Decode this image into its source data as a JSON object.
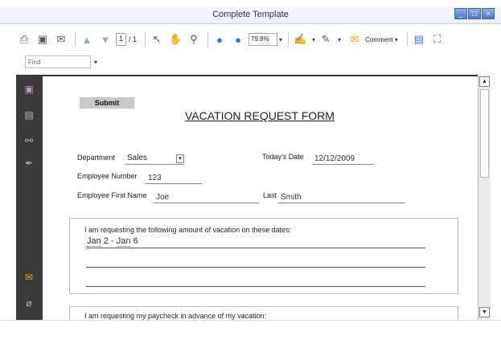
{
  "window": {
    "title": "Complete Template"
  },
  "toolbar": {
    "page_current": "1",
    "page_total": "/ 1",
    "zoom": "79.8%",
    "comment_label": "Comment"
  },
  "find": {
    "placeholder": "Find"
  },
  "form": {
    "submit_label": "Submit",
    "title": "VACATION REQUEST FORM",
    "department_label": "Department",
    "department_value": "Sales",
    "todays_date_label": "Today's Date",
    "todays_date_value": "12/12/2009",
    "employee_number_label": "Employee Number",
    "employee_number_value": "123",
    "first_name_label": "Employee First Name",
    "first_name_value": "Joe",
    "last_label": "Last",
    "last_value": "Smith",
    "vacation_heading": "I am requesting the following amount of vacation on these dates:",
    "vacation_from": "Jan",
    "vacation_range_rest": " 2 - ",
    "vacation_to": "Jan",
    "vacation_end": " 6",
    "paycheck_heading": "I am requesting my paycheck in advance of my vacation:"
  },
  "icons": [
    "print-icon",
    "save-icon",
    "email-icon",
    "prev-page-icon",
    "next-page-icon",
    "select-tool-icon",
    "hand-tool-icon",
    "zoom-tool-icon",
    "zoom-out-icon",
    "zoom-in-icon",
    "sign-icon",
    "highlight-icon",
    "comment-icon",
    "fit-page-icon",
    "fullscreen-icon",
    "pages-panel-icon",
    "attachments-icon",
    "binoculars-icon",
    "signatures-icon",
    "comments-panel-icon",
    "paperclip-icon"
  ]
}
